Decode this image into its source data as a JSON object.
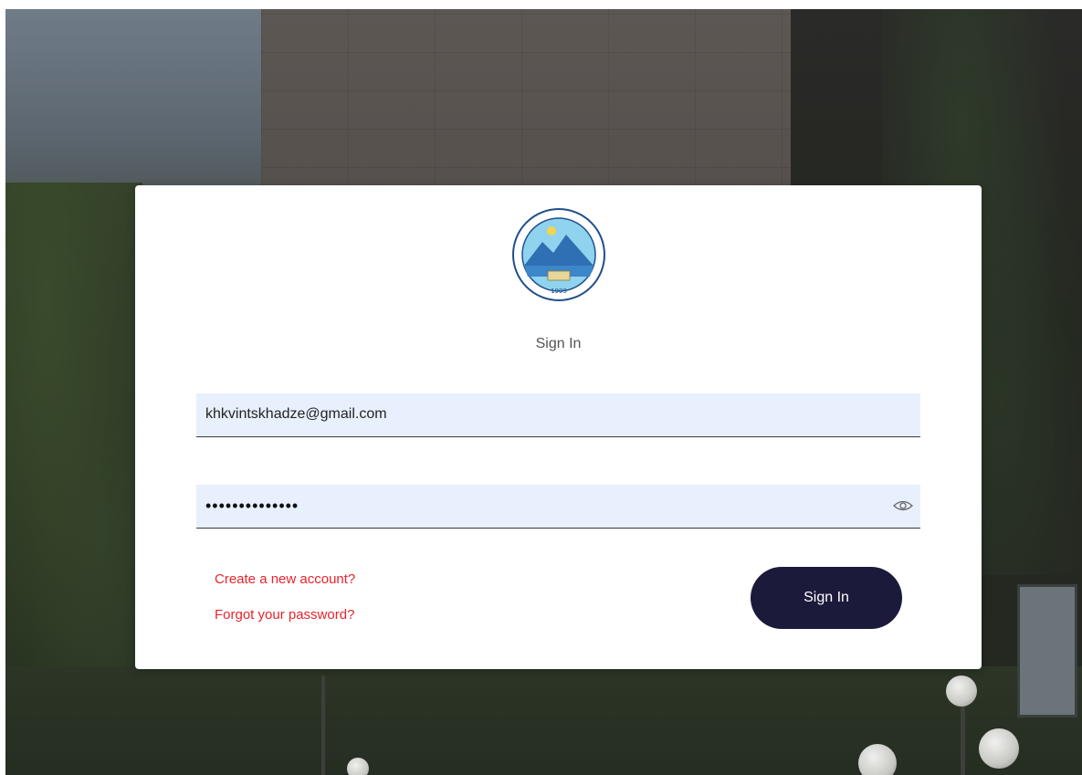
{
  "background": {
    "description_colors": {
      "overlay": "#2b3327"
    }
  },
  "card": {
    "logo_icon": "university-seal-icon",
    "logo_year_text": "1999",
    "title": "Sign In",
    "email": {
      "value": "khkvintskhadze@gmail.com",
      "placeholder": ""
    },
    "password": {
      "value": "••••••••••••••",
      "placeholder": "",
      "toggle_icon": "eye-icon"
    },
    "links": {
      "create_account": "Create a new account?",
      "forgot_password": "Forgot your password?"
    },
    "signin_button": "Sign In"
  },
  "colors": {
    "link": "#e8232c",
    "button_bg": "#1b1a3b",
    "input_bg": "#e8f0fe",
    "card_bg": "#ffffff"
  }
}
